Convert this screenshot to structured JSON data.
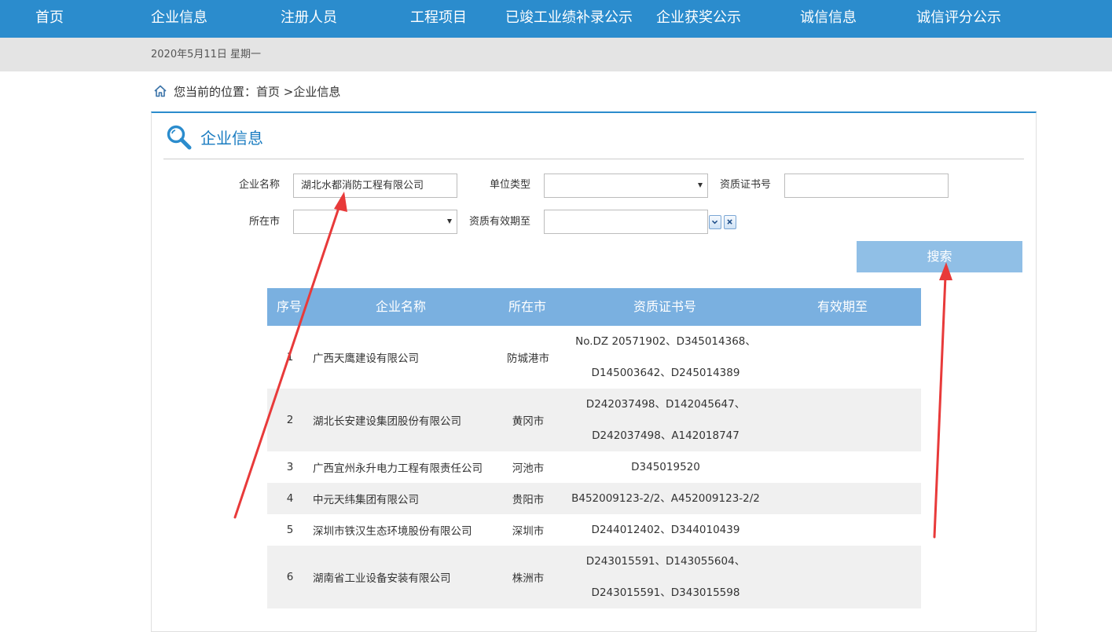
{
  "nav": {
    "items": [
      {
        "label": "首页"
      },
      {
        "label": "企业信息"
      },
      {
        "label": "注册人员"
      },
      {
        "label": "工程项目"
      },
      {
        "label": "已竣工业绩补录公示"
      },
      {
        "label": "企业获奖公示"
      },
      {
        "label": "诚信信息"
      },
      {
        "label": "诚信评分公示"
      }
    ]
  },
  "datebar": {
    "date": "2020年5月11日 星期一"
  },
  "breadcrumb": {
    "prefix": "您当前的位置：",
    "home": "首页",
    "sep": " >",
    "current": "企业信息"
  },
  "panel": {
    "title": "企业信息",
    "accent": "#2b8ccd",
    "title_color": "#1a7cc1"
  },
  "form": {
    "company_name": {
      "label": "企业名称",
      "value": "湖北水都消防工程有限公司"
    },
    "unit_type": {
      "label": "单位类型",
      "value": ""
    },
    "cert_no": {
      "label": "资质证书号",
      "value": ""
    },
    "city": {
      "label": "所在市",
      "value": ""
    },
    "valid_until": {
      "label": "资质有效期至",
      "value": ""
    },
    "search_label": "搜索"
  },
  "table": {
    "headers": {
      "no": "序号",
      "name": "企业名称",
      "city": "所在市",
      "cert": "资质证书号",
      "valid": "有效期至"
    },
    "rows": [
      {
        "no": "1",
        "name": "广西天鹰建设有限公司",
        "city": "防城港市",
        "cert": [
          "No.DZ 20571902、D345014368、",
          "D145003642、D245014389"
        ],
        "valid": ""
      },
      {
        "no": "2",
        "name": "湖北长安建设集团股份有限公司",
        "city": "黄冈市",
        "cert": [
          "D242037498、D142045647、",
          "D242037498、A142018747"
        ],
        "valid": ""
      },
      {
        "no": "3",
        "name": "广西宜州永升电力工程有限责任公司",
        "city": "河池市",
        "cert": [
          "D345019520"
        ],
        "valid": ""
      },
      {
        "no": "4",
        "name": "中元天纬集团有限公司",
        "city": "贵阳市",
        "cert": [
          "B452009123-2/2、A452009123-2/2"
        ],
        "valid": ""
      },
      {
        "no": "5",
        "name": "深圳市铁汉生态环境股份有限公司",
        "city": "深圳市",
        "cert": [
          "D244012402、D344010439"
        ],
        "valid": ""
      },
      {
        "no": "6",
        "name": "湖南省工业设备安装有限公司",
        "city": "株洲市",
        "cert": [
          "D243015591、D143055604、",
          "D243015591、D343015598"
        ],
        "valid": ""
      }
    ]
  },
  "annotations": {
    "arrow_color": "#e83a3a"
  }
}
